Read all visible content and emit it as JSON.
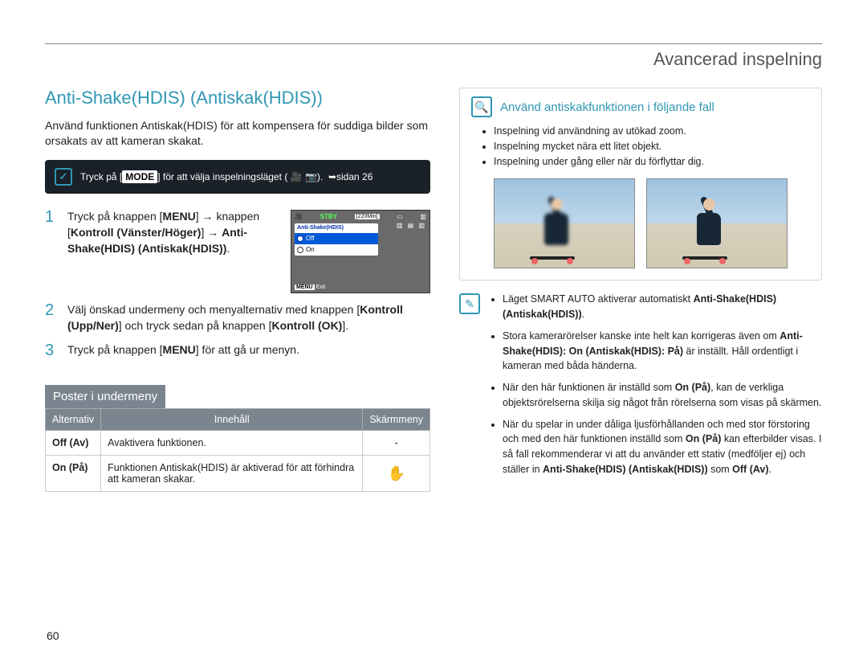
{
  "breadcrumb": "Avancerad inspelning",
  "title": "Anti-Shake(HDIS) (Antiskak(HDIS))",
  "lead": "Använd funktionen Antiskak(HDIS) för att kompensera för suddiga bilder som orsakats av att kameran skakat.",
  "modebox": {
    "pre": "Tryck på [",
    "mode": "MODE",
    "post": "] för att välja inspelningsläget (",
    "vid": "🎥",
    "cam": "📷",
    "post2": ").",
    "arrow": "➥",
    "pageref": "sidan 26"
  },
  "steps": {
    "s1": {
      "n": "1",
      "t1": "Tryck på knappen [",
      "menu": "MENU",
      "t2": "] → knappen [",
      "ctrl": "Kontroll (Vänster/Höger)",
      "t3": "] → ",
      "opt": "Anti-Shake(HDIS) (Antiskak(HDIS))",
      "t4": "."
    },
    "s2": {
      "n": "2",
      "t1": "Välj önskad undermeny och menyalternativ med knappen [",
      "ctrl": "Kontroll (Upp/Ner)",
      "t2": "] och tryck sedan på knappen [",
      "ok": "Kontroll (OK)",
      "t3": "]."
    },
    "s3": {
      "n": "3",
      "t1": "Tryck på knappen [",
      "menu": "MENU",
      "t2": "] för att gå ur menyn."
    }
  },
  "lcd": {
    "stby": "STBY",
    "mins": "[220Min]",
    "hdr": "Anti-Shake(HDIS)",
    "off": "Off",
    "on": "On",
    "exit_tag": "MENU",
    "exit_txt": "Exit"
  },
  "submenu": {
    "header": "Poster i undermeny",
    "cols": {
      "c1": "Alternativ",
      "c2": "Innehåll",
      "c3": "Skärmmeny"
    },
    "rows": [
      {
        "opt": "Off (Av)",
        "desc": "Avaktivera funktionen.",
        "icon": "-"
      },
      {
        "opt": "On (På)",
        "desc": "Funktionen Antiskak(HDIS) är aktiverad för att förhindra att kameran skakar.",
        "icon": "✋"
      }
    ]
  },
  "callout": {
    "title": "Använd antiskakfunktionen i följande fall",
    "bullets": [
      "Inspelning vid användning av utökad zoom.",
      "Inspelning mycket nära ett litet objekt.",
      "Inspelning under gång eller när du förflyttar dig."
    ]
  },
  "notes": [
    {
      "t": "Läget SMART AUTO aktiverar automatiskt ",
      "b": "Anti-Shake(HDIS) (Antiskak(HDIS))",
      "t2": "."
    },
    {
      "t": "Stora kamerarörelser kanske inte helt kan korrigeras även om ",
      "b": "Anti-Shake(HDIS): On (Antiskak(HDIS): På)",
      "t2": " är inställt. Håll ordentligt i kameran med båda händerna."
    },
    {
      "t": "När den här funktionen är inställd som ",
      "b": "On (På)",
      "t2": ", kan de verkliga objektsrörelserna skilja sig något från rörelserna som visas på skärmen."
    },
    {
      "t": "När du spelar in under dåliga ljusförhållanden och med stor förstoring och med den här funktionen inställd som ",
      "b": "On (På)",
      "t2": " kan efterbilder visas. I så fall rekommenderar vi att du använder ett stativ (medföljer ej) och ställer in ",
      "b2": "Anti-Shake(HDIS) (Antiskak(HDIS))",
      "t3": " som ",
      "b3": "Off (Av)",
      "t4": "."
    }
  ],
  "page_number": "60"
}
